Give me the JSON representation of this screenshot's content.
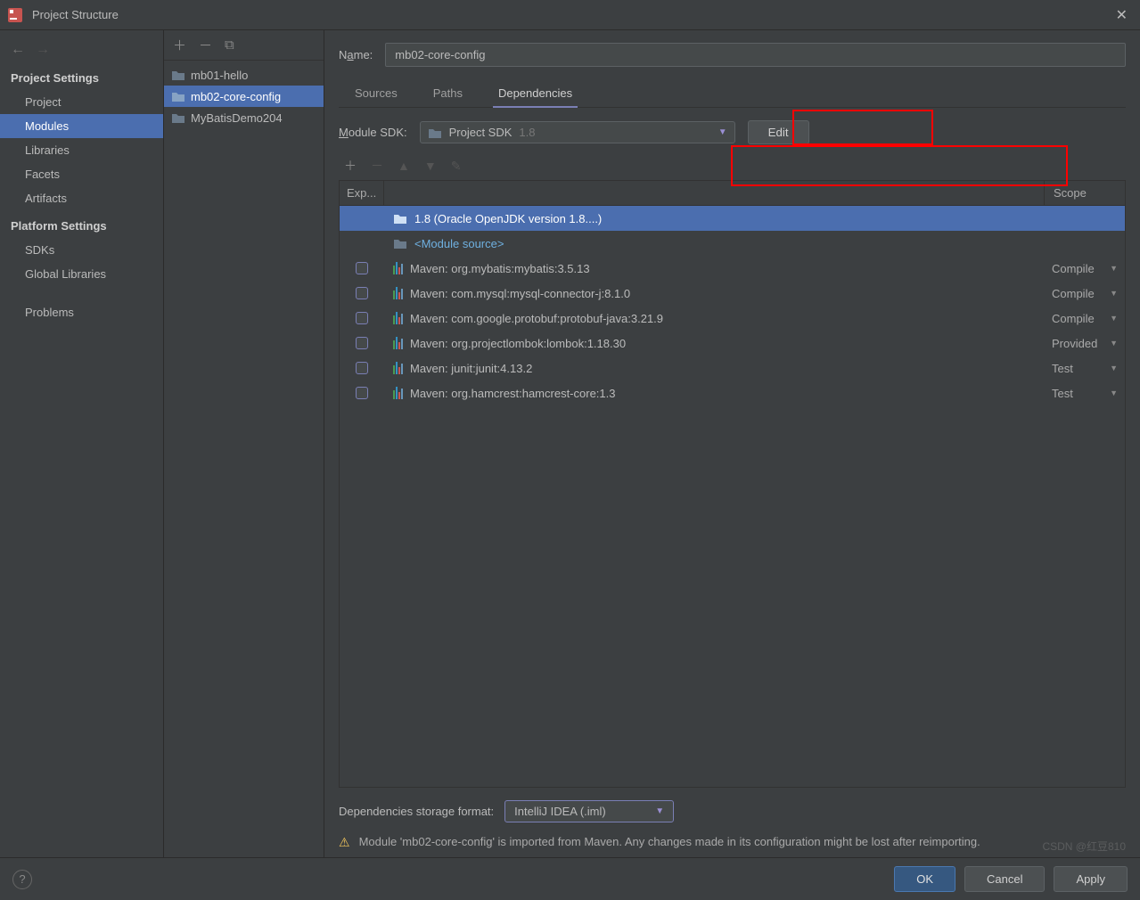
{
  "window": {
    "title": "Project Structure"
  },
  "sidebar": {
    "sections": [
      {
        "title": "Project Settings",
        "items": [
          "Project",
          "Modules",
          "Libraries",
          "Facets",
          "Artifacts"
        ],
        "selected": 1
      },
      {
        "title": "Platform Settings",
        "items": [
          "SDKs",
          "Global Libraries"
        ]
      }
    ],
    "extra": [
      "Problems"
    ]
  },
  "modules": {
    "items": [
      "mb01-hello",
      "mb02-core-config",
      "MyBatisDemo204"
    ],
    "selected": 1
  },
  "content": {
    "nameLabel": "Name:",
    "nameValue": "mb02-core-config",
    "tabs": [
      "Sources",
      "Paths",
      "Dependencies"
    ],
    "activeTab": 2,
    "sdkLabel": "Module SDK:",
    "sdkName": "Project SDK",
    "sdkVersion": "1.8",
    "editLabel": "Edit",
    "depHeader": {
      "export": "Exp...",
      "scope": "Scope"
    },
    "deps": [
      {
        "type": "sdk",
        "label": "1.8 (Oracle OpenJDK version 1.8....)",
        "selected": true
      },
      {
        "type": "source",
        "label": "<Module source>"
      },
      {
        "type": "lib",
        "label": "Maven: org.mybatis:mybatis:3.5.13",
        "scope": "Compile",
        "check": true
      },
      {
        "type": "lib",
        "label": "Maven: com.mysql:mysql-connector-j:8.1.0",
        "scope": "Compile",
        "check": true
      },
      {
        "type": "lib",
        "label": "Maven: com.google.protobuf:protobuf-java:3.21.9",
        "scope": "Compile",
        "check": true
      },
      {
        "type": "lib",
        "label": "Maven: org.projectlombok:lombok:1.18.30",
        "scope": "Provided",
        "check": true
      },
      {
        "type": "lib",
        "label": "Maven: junit:junit:4.13.2",
        "scope": "Test",
        "check": true
      },
      {
        "type": "lib",
        "label": "Maven: org.hamcrest:hamcrest-core:1.3",
        "scope": "Test",
        "check": true
      }
    ],
    "storageLabel": "Dependencies storage format:",
    "storageValue": "IntelliJ IDEA (.iml)",
    "warning": "Module 'mb02-core-config' is imported from Maven. Any changes made in its configuration might be lost after reimporting."
  },
  "footer": {
    "ok": "OK",
    "cancel": "Cancel",
    "apply": "Apply"
  },
  "watermark": "CSDN @红豆810"
}
